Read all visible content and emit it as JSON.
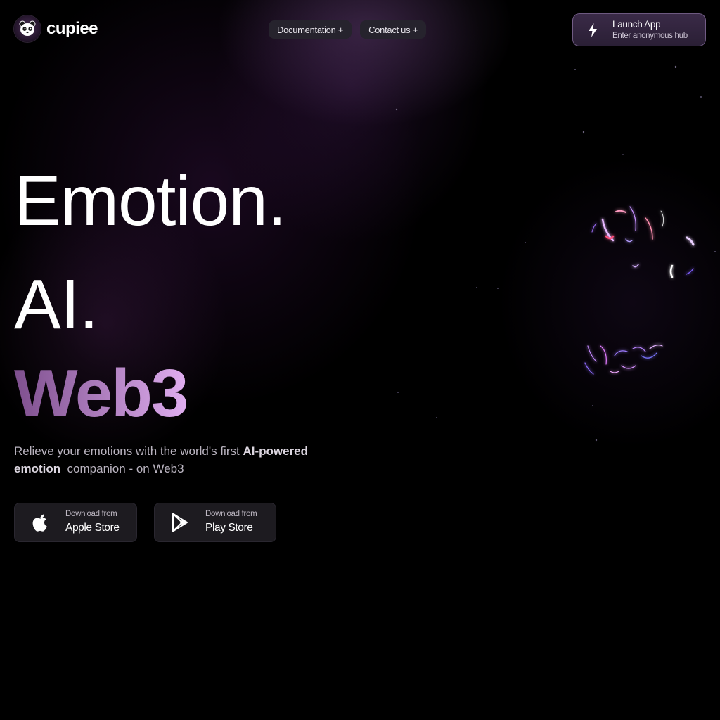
{
  "brand": {
    "name": "cupiee"
  },
  "nav": {
    "items": [
      {
        "label": "Documentation +"
      },
      {
        "label": "Contact us +"
      }
    ]
  },
  "launch": {
    "title": "Launch App",
    "subtitle": "Enter anonymous hub"
  },
  "hero": {
    "line1": "Emotion.",
    "line2": "AI.",
    "line3": "Web3",
    "line3_gradient": [
      "#7e4f8e",
      "#e0aef0"
    ]
  },
  "description": {
    "before": "Relieve your emotions with the world's first ",
    "bold": "AI-powered emotion",
    "after": "  companion - on Web3"
  },
  "downloads": [
    {
      "small": "Download from",
      "store": "Apple Store",
      "icon": "apple-icon"
    },
    {
      "small": "Download from",
      "store": "Play Store",
      "icon": "play-store-icon"
    }
  ],
  "colors": {
    "background": "#000000",
    "accent": "#b282c2",
    "nav_pill": "#26232d",
    "store_button": "#1d1b20"
  }
}
